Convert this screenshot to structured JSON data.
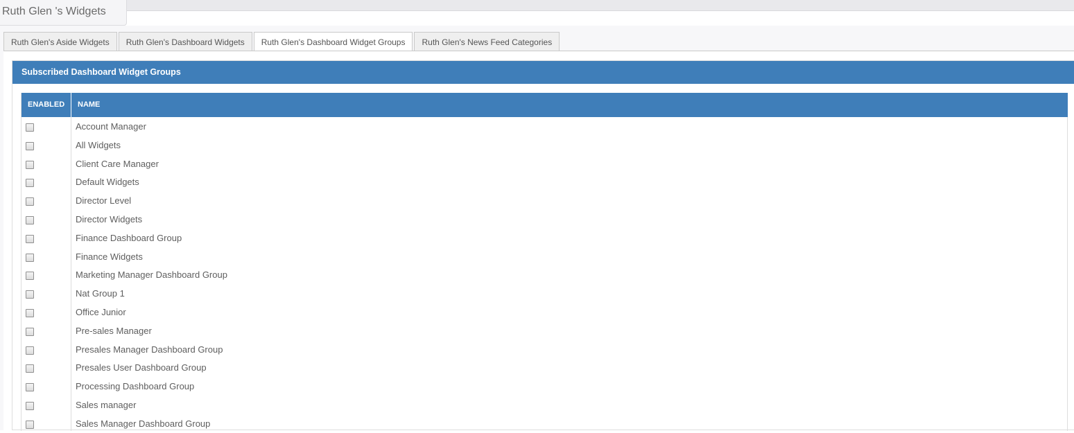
{
  "page": {
    "title": "Ruth Glen 's Widgets"
  },
  "tabs": [
    {
      "label": "Ruth Glen's Aside Widgets",
      "active": false
    },
    {
      "label": "Ruth Glen's Dashboard Widgets",
      "active": false
    },
    {
      "label": "Ruth Glen's Dashboard Widget Groups",
      "active": true
    },
    {
      "label": "Ruth Glen's News Feed Categories",
      "active": false
    }
  ],
  "panel": {
    "title": "Subscribed Dashboard Widget Groups"
  },
  "grid": {
    "columns": {
      "enabled": "ENABLED",
      "name": "NAME"
    },
    "rows": [
      {
        "name": "Account Manager",
        "enabled": false
      },
      {
        "name": "All Widgets",
        "enabled": false
      },
      {
        "name": "Client Care Manager",
        "enabled": false
      },
      {
        "name": "Default Widgets",
        "enabled": false
      },
      {
        "name": "Director Level",
        "enabled": false
      },
      {
        "name": "Director Widgets",
        "enabled": false
      },
      {
        "name": "Finance Dashboard Group",
        "enabled": false
      },
      {
        "name": "Finance Widgets",
        "enabled": false
      },
      {
        "name": "Marketing Manager Dashboard Group",
        "enabled": false
      },
      {
        "name": "Nat Group 1",
        "enabled": false
      },
      {
        "name": "Office Junior",
        "enabled": false
      },
      {
        "name": "Pre-sales Manager",
        "enabled": false
      },
      {
        "name": "Presales Manager Dashboard Group",
        "enabled": false
      },
      {
        "name": "Presales User Dashboard Group",
        "enabled": false
      },
      {
        "name": "Processing Dashboard Group",
        "enabled": false
      },
      {
        "name": "Sales manager",
        "enabled": false
      },
      {
        "name": "Sales Manager Dashboard Group",
        "enabled": false
      }
    ]
  },
  "colors": {
    "header_blue": "#3f7eb9",
    "text_gray": "#5e5e5e"
  }
}
